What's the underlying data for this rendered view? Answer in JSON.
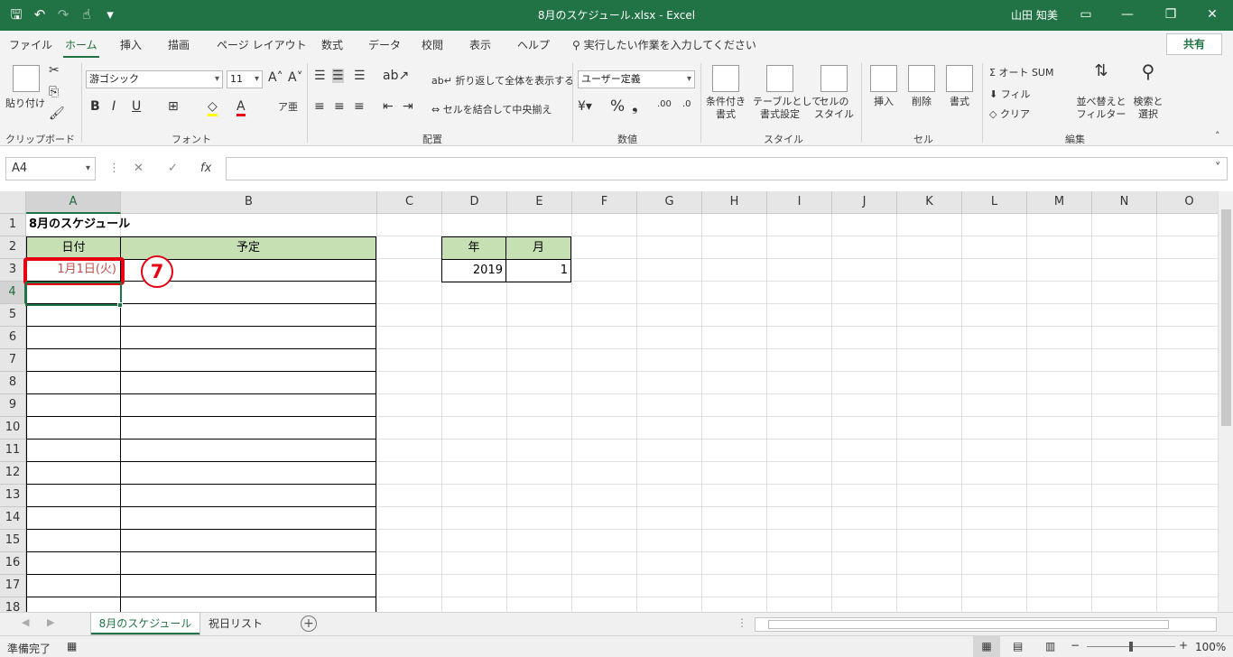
{
  "titlebar": {
    "qat": {
      "save_icon": "🖫",
      "undo_icon": "↶",
      "redo_icon": "↷",
      "touch_icon": "☝",
      "customize_icon": "▾"
    },
    "title": "8月のスケジュール.xlsx  -  Excel",
    "user": "山田 知美",
    "ribbon_display_icon": "▭",
    "minimize": "—",
    "restore": "❐",
    "close": "✕"
  },
  "tabs": [
    "ファイル",
    "ホーム",
    "挿入",
    "描画",
    "ページ レイアウト",
    "数式",
    "データ",
    "校閲",
    "表示",
    "ヘルプ"
  ],
  "tell_me": "実行したい作業を入力してください",
  "share": "共有",
  "ribbon": {
    "clipboard": {
      "label": "クリップボード",
      "paste": "貼り付け"
    },
    "font": {
      "label": "フォント",
      "name": "游ゴシック",
      "size": "11",
      "bold": "B",
      "italic": "I",
      "underline": "U"
    },
    "alignment": {
      "label": "配置",
      "wrap": "折り返して全体を表示する",
      "merge": "セルを結合して中央揃え"
    },
    "number": {
      "label": "数値",
      "format": "ユーザー定義",
      "percent": "%",
      "comma": "❟"
    },
    "styles": {
      "label": "スタイル",
      "conditional": "条件付き\n書式",
      "table": "テーブルとして\n書式設定",
      "cell": "セルの\nスタイル"
    },
    "cells": {
      "label": "セル",
      "insert": "挿入",
      "delete": "削除",
      "format": "書式"
    },
    "editing": {
      "label": "編集",
      "autosum": "オート SUM",
      "fill": "フィル",
      "clear": "クリア",
      "sort": "並べ替えと\nフィルター",
      "find": "検索と\n選択"
    }
  },
  "formula_bar": {
    "name_box": "A4",
    "cancel": "✕",
    "enter": "✓",
    "fx": "fx",
    "value": ""
  },
  "columns": [
    "A",
    "B",
    "C",
    "D",
    "E",
    "F",
    "G",
    "H",
    "I",
    "J",
    "K",
    "L",
    "M",
    "N",
    "O"
  ],
  "rows": [
    "1",
    "2",
    "3",
    "4",
    "5",
    "6",
    "7",
    "8",
    "9",
    "10",
    "11",
    "12",
    "13",
    "14",
    "15",
    "16",
    "17",
    "18"
  ],
  "cells": {
    "A1": "8月のスケジュール",
    "A2": "日付",
    "B2": "予定",
    "A3": "1月1日(火)",
    "D2": "年",
    "E2": "月",
    "D3": "2019",
    "E3": "1"
  },
  "annotation": {
    "step": "7",
    "color": "#e60012"
  },
  "sheet_tabs": [
    "8月のスケジュール",
    "祝日リスト"
  ],
  "add_sheet": "+",
  "status": {
    "ready": "準備完了",
    "zoom": "100%",
    "minus": "−",
    "plus": "+"
  },
  "colors": {
    "accent": "#217346",
    "header_fill": "#c6e0b4",
    "date_text": "#c0504d"
  }
}
